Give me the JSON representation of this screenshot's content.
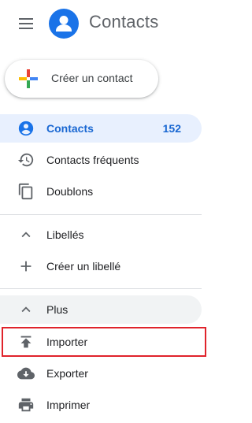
{
  "app": {
    "title": "Contacts"
  },
  "create_button": {
    "label": "Créer un contact"
  },
  "nav": {
    "contacts": {
      "label": "Contacts",
      "count": "152"
    },
    "frequent": {
      "label": "Contacts fréquents"
    },
    "duplicates": {
      "label": "Doublons"
    },
    "labels_header": {
      "label": "Libellés"
    },
    "create_label": {
      "label": "Créer un libellé"
    },
    "more_header": {
      "label": "Plus"
    },
    "import": {
      "label": "Importer"
    },
    "export": {
      "label": "Exporter"
    },
    "print": {
      "label": "Imprimer"
    }
  },
  "icons": {
    "menu": "hamburger-menu-icon",
    "logo": "contacts-logo-icon",
    "plus": "multicolor-plus-icon",
    "contacts": "person-circle-icon",
    "frequent": "history-icon",
    "duplicates": "copy-icon",
    "labels": "chevron-up-icon",
    "create_label": "plus-icon",
    "more": "chevron-up-icon",
    "import": "upload-icon",
    "export": "cloud-download-icon",
    "print": "printer-icon"
  },
  "colors": {
    "accent": "#1a73e8",
    "active_bg": "#e8f0fe",
    "active_text": "#1967d2",
    "icon_gray": "#5f6368",
    "highlight_border": "#e0232b"
  }
}
